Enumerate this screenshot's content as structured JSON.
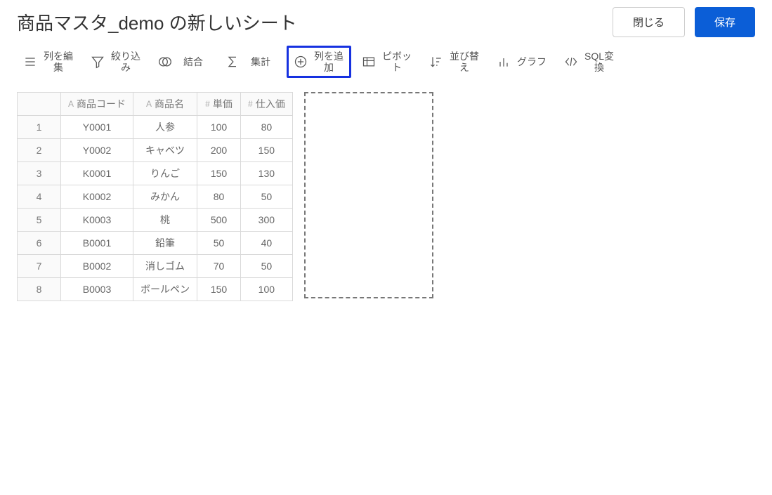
{
  "title": "商品マスタ_demo の新しいシート",
  "buttons": {
    "close": "閉じる",
    "save": "保存"
  },
  "toolbar": {
    "edit_col": "列を編集",
    "filter": "絞り込み",
    "join": "結合",
    "aggregate": "集計",
    "add_col": "列を追加",
    "pivot": "ピボット",
    "sort": "並び替え",
    "chart": "グラフ",
    "sql": "SQL変換"
  },
  "table": {
    "columns": [
      {
        "type": "A",
        "name": "商品コード"
      },
      {
        "type": "A",
        "name": "商品名"
      },
      {
        "type": "#",
        "name": "単価"
      },
      {
        "type": "#",
        "name": "仕入価"
      }
    ],
    "rows": [
      {
        "n": "1",
        "c0": "Y0001",
        "c1": "人参",
        "c2": "100",
        "c3": "80"
      },
      {
        "n": "2",
        "c0": "Y0002",
        "c1": "キャベツ",
        "c2": "200",
        "c3": "150"
      },
      {
        "n": "3",
        "c0": "K0001",
        "c1": "りんご",
        "c2": "150",
        "c3": "130"
      },
      {
        "n": "4",
        "c0": "K0002",
        "c1": "みかん",
        "c2": "80",
        "c3": "50"
      },
      {
        "n": "5",
        "c0": "K0003",
        "c1": "桃",
        "c2": "500",
        "c3": "300"
      },
      {
        "n": "6",
        "c0": "B0001",
        "c1": "鉛筆",
        "c2": "50",
        "c3": "40"
      },
      {
        "n": "7",
        "c0": "B0002",
        "c1": "消しゴム",
        "c2": "70",
        "c3": "50"
      },
      {
        "n": "8",
        "c0": "B0003",
        "c1": "ボールペン",
        "c2": "150",
        "c3": "100"
      }
    ]
  }
}
